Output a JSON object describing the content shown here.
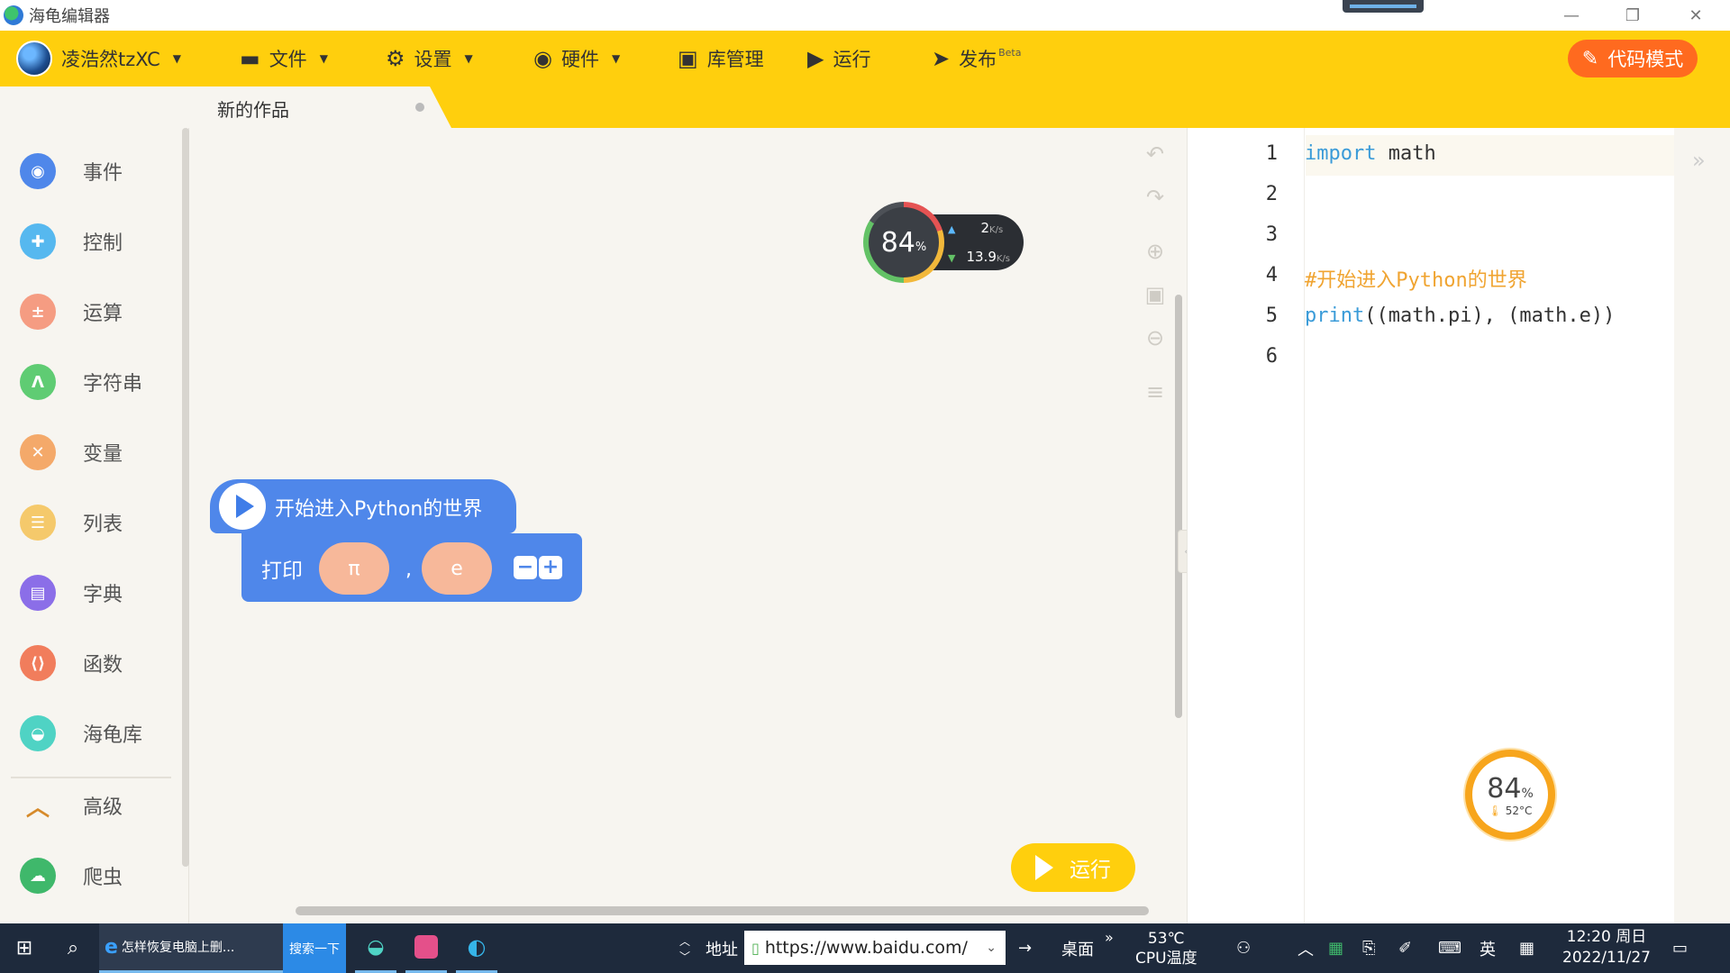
{
  "window": {
    "title": "海龟编辑器"
  },
  "toolbar": {
    "user_name": "凌浩然tzXC",
    "menu": [
      {
        "label": "文件"
      },
      {
        "label": "设置"
      },
      {
        "label": "硬件"
      },
      {
        "label": "库管理"
      },
      {
        "label": "运行"
      },
      {
        "label": "发布",
        "badge": "Beta"
      }
    ],
    "code_mode_label": "代码模式",
    "accent_color": "#ffcf0d",
    "code_mode_color": "#ff6a1f"
  },
  "tab": {
    "label": "新的作品"
  },
  "sidebar": {
    "categories": [
      {
        "label": "事件",
        "icon": "toggle-icon",
        "color": "#4f87ea"
      },
      {
        "label": "控制",
        "icon": "gamepad-icon",
        "color": "#56b8ef"
      },
      {
        "label": "运算",
        "icon": "calculator-icon",
        "color": "#f59c82"
      },
      {
        "label": "字符串",
        "icon": "letter-a-icon",
        "color": "#5fcc73"
      },
      {
        "label": "变量",
        "icon": "letter-x-icon",
        "color": "#f4a96a"
      },
      {
        "label": "列表",
        "icon": "list-icon",
        "color": "#f5c96b"
      },
      {
        "label": "字典",
        "icon": "book-icon",
        "color": "#8b6ee8"
      },
      {
        "label": "函数",
        "icon": "code-icon",
        "color": "#f17d5c"
      },
      {
        "label": "海龟库",
        "icon": "turtle-icon",
        "color": "#4fd3c4"
      },
      {
        "label": "高级",
        "icon": "chevron-up-icon",
        "color": "#d68a2a"
      },
      {
        "label": "爬虫",
        "icon": "spider-icon",
        "color": "#3fb86b"
      }
    ]
  },
  "blocks": {
    "hat_label": "开始进入Python的世界",
    "print_label": "打印",
    "arg1": "π",
    "arg2": "e",
    "separator": ",",
    "minus": "−",
    "plus": "+"
  },
  "workspace": {
    "run_label": "运行"
  },
  "net_widget": {
    "cpu_value": "84",
    "percent_sign": "%",
    "up_value": "2",
    "up_unit": "K/s",
    "down_value": "13.9",
    "down_unit": "K/s"
  },
  "code": {
    "line_numbers": [
      "1",
      "2",
      "3",
      "4",
      "5",
      "6"
    ],
    "line1_kw": "import",
    "line1_rest": " math",
    "line4": "#开始进入Python的世界",
    "line5_kw": "print",
    "line5_rest": "((math.pi), (math.e))"
  },
  "cpu_widget": {
    "value": "84",
    "percent_sign": "%",
    "temp": "52°C"
  },
  "taskbar": {
    "ie_task_label": "怎样恢复电脑上删...",
    "search_button": "搜索一下",
    "address_label": "地址",
    "address_url": "https://www.baidu.com/",
    "desktop_label": "桌面",
    "cpu_temp_value": "53℃",
    "cpu_temp_label": "CPU温度",
    "ime_label": "英",
    "clock_time": "12:20 周日",
    "clock_date": "2022/11/27"
  }
}
